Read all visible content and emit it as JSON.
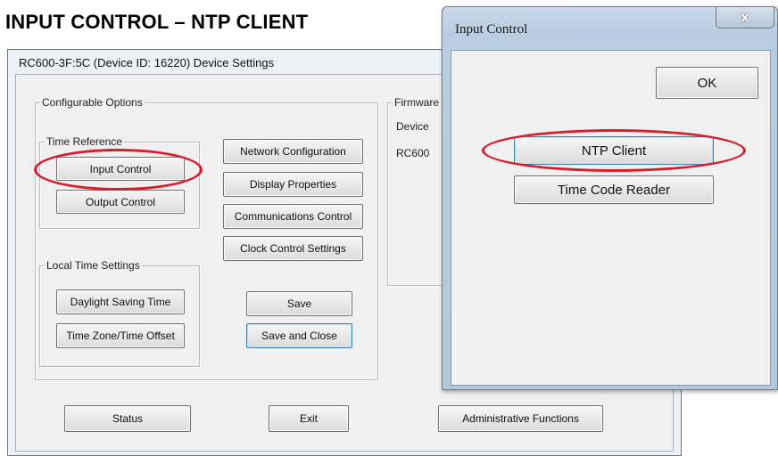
{
  "heading": "INPUT CONTROL – NTP CLIENT",
  "main_window": {
    "title": "RC600-3F:5C (Device ID: 16220) Device Settings",
    "configurable_options": {
      "legend": "Configurable Options",
      "time_reference": {
        "legend": "Time Reference",
        "input_control": "Input Control",
        "output_control": "Output Control"
      },
      "local_time_settings": {
        "legend": "Local Time Settings",
        "daylight_saving": "Daylight Saving Time",
        "time_zone": "Time Zone/Time Offset"
      },
      "network_configuration": "Network Configuration",
      "display_properties": "Display Properties",
      "communications_control": "Communications Control",
      "clock_control_settings": "Clock Control Settings",
      "save": "Save",
      "save_and_close": "Save and Close"
    },
    "firmware": {
      "legend": "Firmware",
      "device_label": "Device",
      "device_value": "RC600"
    },
    "bottom": {
      "status": "Status",
      "exit": "Exit",
      "administrative_functions": "Administrative Functions"
    }
  },
  "input_control_window": {
    "title": "Input Control",
    "close_glyph": "x",
    "ok": "OK",
    "ntp_client": "NTP Client",
    "time_code_reader": "Time Code Reader"
  },
  "highlight_color": "#d81e2a"
}
